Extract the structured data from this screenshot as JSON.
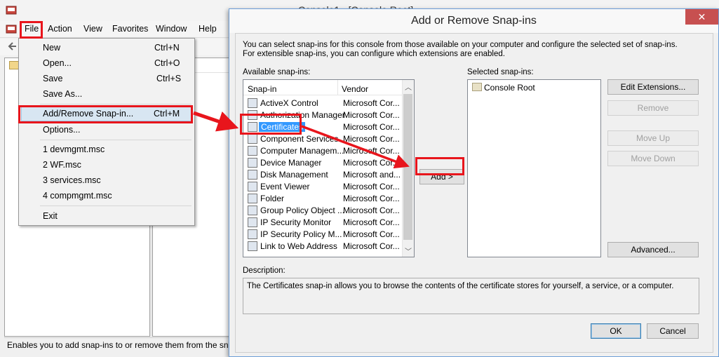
{
  "mmc": {
    "title": "Console1 - [Console Root]",
    "menu": [
      "File",
      "Action",
      "View",
      "Favorites",
      "Window",
      "Help"
    ],
    "status": "Enables you to add snap-ins to or remove them from the sna"
  },
  "file_menu": {
    "items": [
      {
        "label": "New",
        "accel": "Ctrl+N"
      },
      {
        "label": "Open...",
        "accel": "Ctrl+O"
      },
      {
        "label": "Save",
        "accel": "Ctrl+S"
      },
      {
        "label": "Save As...",
        "accel": ""
      },
      {
        "label": "Add/Remove Snap-in...",
        "accel": "Ctrl+M"
      },
      {
        "label": "Options...",
        "accel": ""
      },
      {
        "label": "1 devmgmt.msc",
        "accel": ""
      },
      {
        "label": "2 WF.msc",
        "accel": ""
      },
      {
        "label": "3 services.msc",
        "accel": ""
      },
      {
        "label": "4 compmgmt.msc",
        "accel": ""
      },
      {
        "label": "Exit",
        "accel": ""
      }
    ]
  },
  "dialog": {
    "title": "Add or Remove Snap-ins",
    "close_glyph": "✕",
    "intro": "You can select snap-ins for this console from those available on your computer and configure the selected set of snap-ins. For extensible snap-ins, you can configure which extensions are enabled.",
    "available_label": "Available snap-ins:",
    "selected_label": "Selected snap-ins:",
    "col_snapin": "Snap-in",
    "col_vendor": "Vendor",
    "snapins": [
      {
        "name": "ActiveX Control",
        "vendor": "Microsoft Cor..."
      },
      {
        "name": "Authorization Manager",
        "vendor": "Microsoft Cor..."
      },
      {
        "name": "Certificates",
        "vendor": "Microsoft Cor..."
      },
      {
        "name": "Component Services",
        "vendor": "Microsoft Cor..."
      },
      {
        "name": "Computer Managem...",
        "vendor": "Microsoft Cor..."
      },
      {
        "name": "Device Manager",
        "vendor": "Microsoft Cor..."
      },
      {
        "name": "Disk Management",
        "vendor": "Microsoft and..."
      },
      {
        "name": "Event Viewer",
        "vendor": "Microsoft Cor..."
      },
      {
        "name": "Folder",
        "vendor": "Microsoft Cor..."
      },
      {
        "name": "Group Policy Object ...",
        "vendor": "Microsoft Cor..."
      },
      {
        "name": "IP Security Monitor",
        "vendor": "Microsoft Cor..."
      },
      {
        "name": "IP Security Policy M...",
        "vendor": "Microsoft Cor..."
      },
      {
        "name": "Link to Web Address",
        "vendor": "Microsoft Cor..."
      }
    ],
    "selected_index": 2,
    "selected_snapins": [
      "Console Root"
    ],
    "add_button": "Add >",
    "edit_extensions": "Edit Extensions...",
    "remove": "Remove",
    "move_up": "Move Up",
    "move_down": "Move Down",
    "advanced": "Advanced...",
    "description_label": "Description:",
    "description": "The Certificates snap-in allows you to browse the contents of the certificate stores for yourself, a service, or a computer.",
    "ok": "OK",
    "cancel": "Cancel"
  },
  "colors": {
    "annotation_red": "#e8151c",
    "selection_blue": "#3399ff"
  }
}
